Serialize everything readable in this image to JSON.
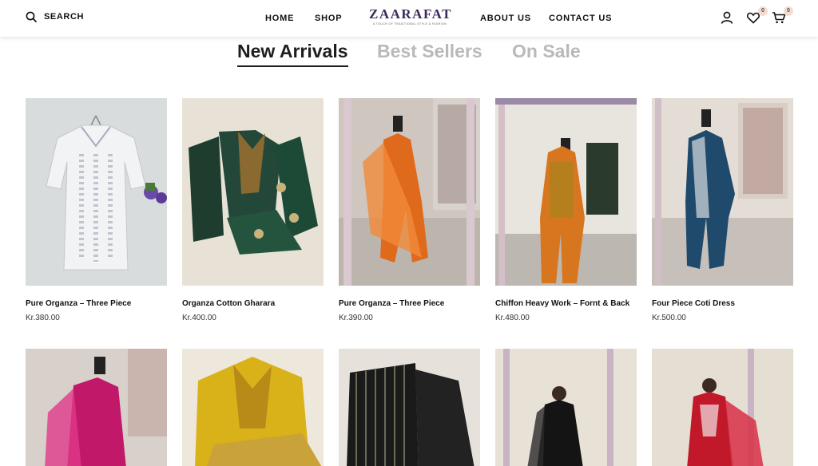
{
  "header": {
    "search_label": "SEARCH",
    "nav": [
      "HOME",
      "SHOP",
      "ABOUT US",
      "CONTACT US"
    ],
    "logo": "ZAARAFAT",
    "logo_tagline": "A TOUCH OF TRADITIONAL STYLE & FASHION",
    "wishlist_count": "0",
    "cart_count": "0",
    "icons": [
      "search-icon",
      "user-icon",
      "heart-icon",
      "cart-icon"
    ]
  },
  "tabs": [
    {
      "label": "New Arrivals",
      "active": true
    },
    {
      "label": "Best Sellers",
      "active": false
    },
    {
      "label": "On Sale",
      "active": false
    }
  ],
  "products": [
    {
      "name": "Pure Organza – Three Piece",
      "price": "Kr.380.00"
    },
    {
      "name": "Organza Cotton Gharara",
      "price": "Kr.400.00"
    },
    {
      "name": "Pure Organza – Three Piece",
      "price": "Kr.390.00"
    },
    {
      "name": "Chiffon Heavy Work – Fornt & Back",
      "price": "Kr.480.00"
    },
    {
      "name": "Four Piece Coti Dress",
      "price": "Kr.500.00"
    }
  ],
  "colors": {
    "text": "#111111",
    "inactive_tab": "#b9b9b9",
    "badge_bg": "#f3ddd2",
    "logo": "#3a2a5a"
  }
}
